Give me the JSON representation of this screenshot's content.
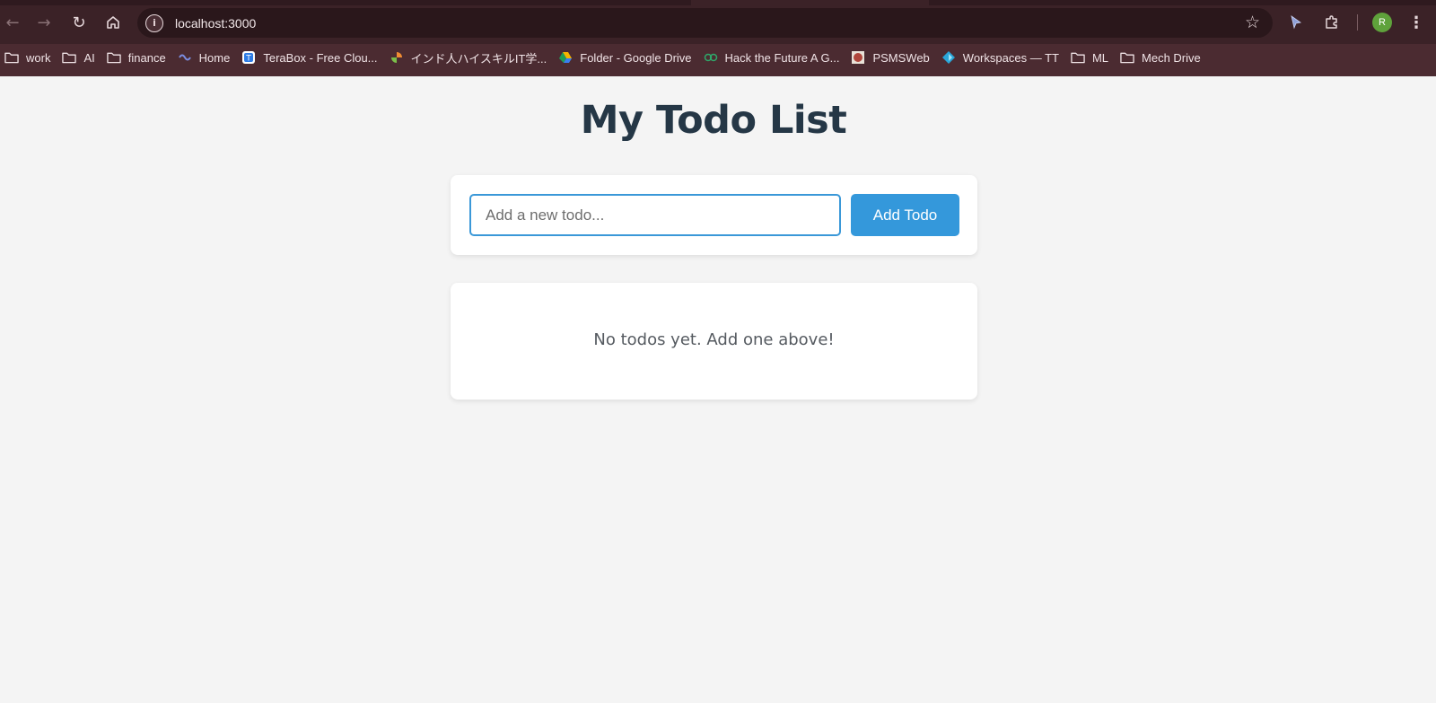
{
  "browser": {
    "url": "localhost:3000",
    "profile_initial": "R",
    "bookmarks": [
      {
        "label": "work",
        "icon": "folder-icon"
      },
      {
        "label": "AI",
        "icon": "folder-icon"
      },
      {
        "label": "finance",
        "icon": "folder-icon"
      },
      {
        "label": "Home",
        "icon": "home-link-icon"
      },
      {
        "label": "TeraBox - Free Clou...",
        "icon": "terabox-icon"
      },
      {
        "label": "インド人ハイスキルIT学...",
        "icon": "site-icon"
      },
      {
        "label": "Folder - Google Drive",
        "icon": "google-drive-icon"
      },
      {
        "label": "Hack the Future A G...",
        "icon": "site-icon"
      },
      {
        "label": "PSMSWeb",
        "icon": "site-icon"
      },
      {
        "label": "Workspaces — TT",
        "icon": "site-icon"
      },
      {
        "label": "ML",
        "icon": "folder-icon"
      },
      {
        "label": "Mech Drive",
        "icon": "folder-icon"
      }
    ]
  },
  "app": {
    "title": "My Todo List",
    "input_placeholder": "Add a new todo...",
    "add_button_label": "Add Todo",
    "empty_message": "No todos yet. Add one above!"
  },
  "colors": {
    "accent": "#3498db",
    "title": "#253746",
    "background": "#f4f4f4"
  }
}
